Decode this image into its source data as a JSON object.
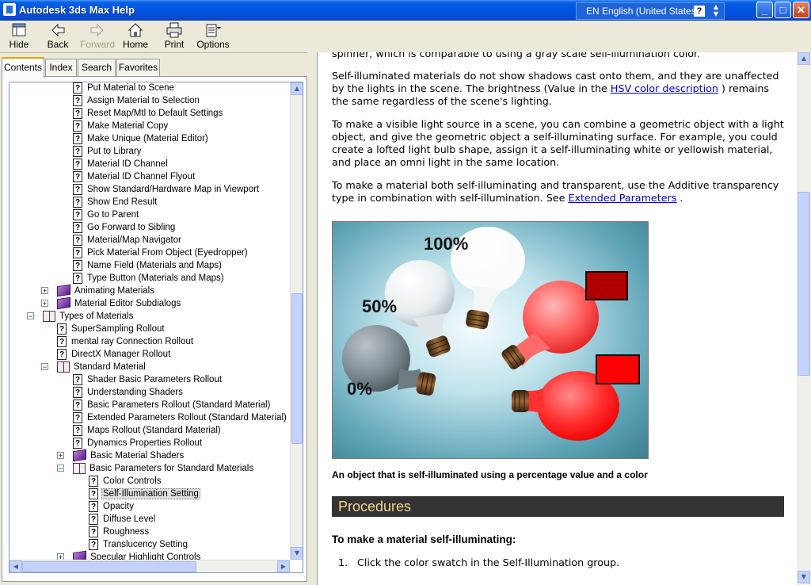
{
  "window": {
    "title": "Autodesk 3ds Max Help",
    "language": "EN English (United States)",
    "help_glyph": "?",
    "controls": {
      "minimize": "_",
      "maximize": "□",
      "close": "✕"
    }
  },
  "toolbar": {
    "hide": "Hide",
    "back": "Back",
    "forward": "Forward",
    "home": "Home",
    "print": "Print",
    "options": "Options"
  },
  "nav_tabs": {
    "contents": "Contents",
    "index": "Index",
    "search": "Search",
    "favorites": "Favorites",
    "active": "Contents"
  },
  "tree": {
    "items": [
      {
        "label": "Put Material to Scene",
        "icon": "page-icon"
      },
      {
        "label": "Assign Material to Selection",
        "icon": "page-icon"
      },
      {
        "label": "Reset Map/Mtl to Default Settings",
        "icon": "page-icon"
      },
      {
        "label": "Make Material Copy",
        "icon": "page-icon"
      },
      {
        "label": "Make Unique (Material Editor)",
        "icon": "page-icon"
      },
      {
        "label": "Put to Library",
        "icon": "page-icon"
      },
      {
        "label": "Material ID Channel",
        "icon": "page-icon"
      },
      {
        "label": "Material ID Channel Flyout",
        "icon": "page-icon"
      },
      {
        "label": "Show Standard/Hardware Map in Viewport",
        "icon": "page-icon"
      },
      {
        "label": "Show End Result",
        "icon": "page-icon"
      },
      {
        "label": "Go to Parent",
        "icon": "page-icon"
      },
      {
        "label": "Go Forward to Sibling",
        "icon": "page-icon"
      },
      {
        "label": "Material/Map Navigator",
        "icon": "page-icon"
      },
      {
        "label": "Pick Material From Object (Eyedropper)",
        "icon": "page-icon"
      },
      {
        "label": "Name Field (Materials and Maps)",
        "icon": "page-icon"
      },
      {
        "label": "Type Button (Materials and Maps)",
        "icon": "page-icon"
      },
      {
        "label": "Animating Materials",
        "icon": "book-closed-icon",
        "expander": "+"
      },
      {
        "label": "Material Editor Subdialogs",
        "icon": "book-closed-icon",
        "expander": "+"
      },
      {
        "label": "Types of Materials",
        "icon": "book-open-icon",
        "expander": "−"
      },
      {
        "label": "SuperSampling Rollout",
        "icon": "page-icon"
      },
      {
        "label": "mental ray Connection Rollout",
        "icon": "page-icon"
      },
      {
        "label": "DirectX Manager Rollout",
        "icon": "page-icon"
      },
      {
        "label": "Standard Material",
        "icon": "book-open-icon",
        "expander": "−"
      },
      {
        "label": "Shader Basic Parameters Rollout",
        "icon": "page-icon"
      },
      {
        "label": "Understanding Shaders",
        "icon": "page-icon"
      },
      {
        "label": "Basic Parameters Rollout (Standard Material)",
        "icon": "page-icon"
      },
      {
        "label": "Extended Parameters Rollout (Standard Material)",
        "icon": "page-icon"
      },
      {
        "label": "Maps Rollout (Standard Material)",
        "icon": "page-icon"
      },
      {
        "label": "Dynamics Properties Rollout",
        "icon": "page-icon"
      },
      {
        "label": "Basic Material Shaders",
        "icon": "book-closed-icon",
        "expander": "+"
      },
      {
        "label": "Basic Parameters for Standard Materials",
        "icon": "book-open-icon",
        "expander": "−"
      },
      {
        "label": "Color Controls",
        "icon": "page-icon"
      },
      {
        "label": "Self-Illumination Setting",
        "icon": "page-icon",
        "selected": true
      },
      {
        "label": "Opacity",
        "icon": "page-icon"
      },
      {
        "label": "Diffuse Level",
        "icon": "page-icon"
      },
      {
        "label": "Roughness",
        "icon": "page-icon"
      },
      {
        "label": "Translucency Setting",
        "icon": "page-icon"
      },
      {
        "label": "Specular Highlight Controls",
        "icon": "book-closed-icon",
        "expander": "+"
      }
    ]
  },
  "article": {
    "top_fragment": "spinner, which is comparable to using a gray scale self-illumination color.",
    "p1_a": "Self-illuminated materials do not show shadows cast onto them, and they are unaffected by the lights in the scene. The brightness (Value in the ",
    "p1_link": "HSV color description",
    "p1_b": " ) remains the same regardless of the scene's lighting.",
    "p2": "To make a visible light source in a scene, you can combine a geometric object with a light object, and give the geometric object a self-illuminating surface. For example, you could create a lofted light bulb shape, assign it a self-illuminating white or yellowish material, and place an omni light in the same location.",
    "p3_a": "To make a material both self-illuminating and transparent, use the Additive transparency type in combination with self-illumination. See ",
    "p3_link": "Extended Parameters",
    "p3_b": " .",
    "figure": {
      "label_100": "100%",
      "label_50": "50%",
      "label_0": "0%"
    },
    "caption": "An object that is self-illuminated using a percentage value and a color",
    "procedures_heading": "Procedures",
    "steps_title": "To make a material self-illuminating:",
    "step1_num": "1.",
    "step1": "Click the color swatch in the Self-Illumination group."
  },
  "colors": {
    "titlebar": "#0054e3",
    "link": "#0000cc",
    "procedures_bg": "#333333",
    "procedures_text": "#f4d58c",
    "swatch_dark_red": "#b00000",
    "swatch_red": "#ff0000"
  }
}
